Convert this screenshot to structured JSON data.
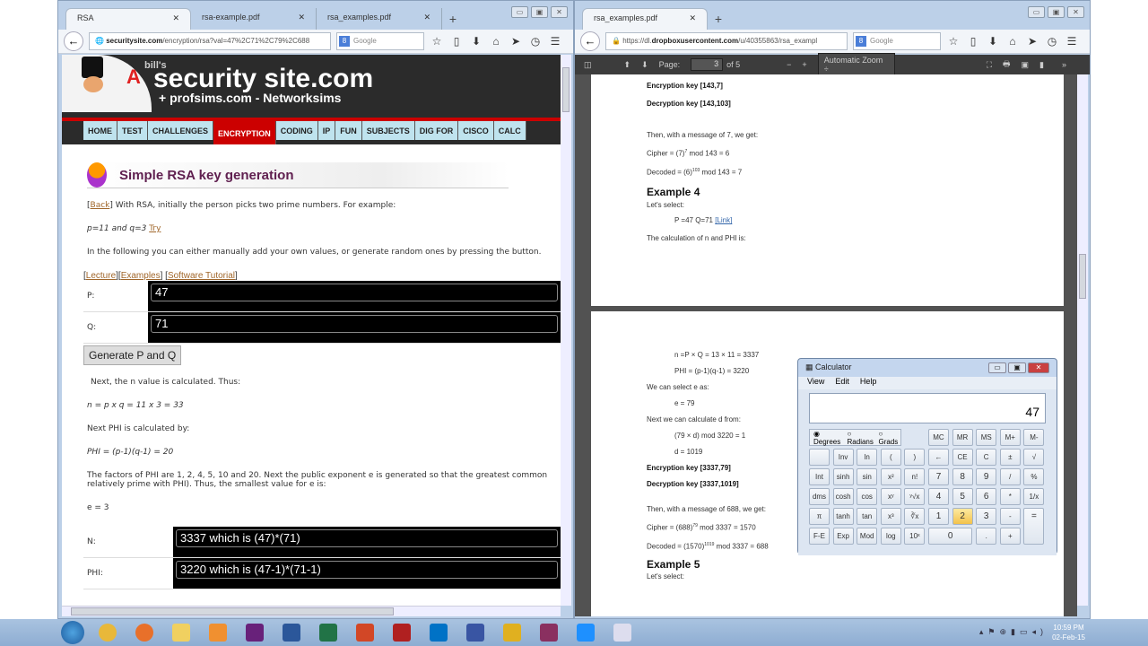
{
  "left_browser": {
    "tabs": [
      {
        "label": "RSA"
      },
      {
        "label": "rsa-example.pdf"
      },
      {
        "label": "rsa_examples.pdf"
      }
    ],
    "url_domain": "securitysite.com",
    "url_path": "/encryption/rsa?val=47%2C71%2C79%2C688",
    "search_placeholder": "Google",
    "site": {
      "logo_small": "bill's",
      "logo_main": "security site.com",
      "logo_sub": "+ profsims.com - Networksims",
      "logo_letter": "A",
      "nav": [
        "HOME",
        "TEST",
        "CHALLENGES",
        "ENCRYPTION",
        "CODING",
        "IP",
        "FUN",
        "SUBJECTS",
        "DIG FOR",
        "CISCO",
        "CALC"
      ],
      "title": "Simple RSA key generation",
      "intro_back": "Back",
      "intro": "With RSA, initially the person picks two prime numbers. For example:",
      "example": "p=11 and q=3",
      "try": "Try",
      "following": "In the following you can either manually add your own values, or generate random ones by pressing the button.",
      "links": [
        "Lecture",
        "Examples",
        "Software Tutorial"
      ],
      "p_label": "P:",
      "p_value": "47",
      "q_label": "Q:",
      "q_value": "71",
      "generate": "Generate P and Q",
      "next_n": "Next, the n value is calculated. Thus:",
      "n_eq": "n = p x q = 11 x 3 = 33",
      "next_phi": "Next PHI is calculated by:",
      "phi_eq": "PHI = (p-1)(q-1) = 20",
      "factors": "The factors of PHI are 1, 2, 4, 5, 10 and 20. Next the public exponent e is generated so that the greatest common",
      "factors2": "relatively prime with PHI). Thus, the smallest value for e is:",
      "e_eq": "e = 3",
      "n_label": "N:",
      "n_value": "3337 which is (47)*(71)",
      "phi_label": "PHI:",
      "phi_value": "3220 which is (47-1)*(71-1)"
    }
  },
  "right_browser": {
    "tabs": [
      {
        "label": "rsa_examples.pdf"
      }
    ],
    "url_prefix": "https://dl.",
    "url_domain": "dropboxusercontent.com",
    "url_path": "/u/40355863/rsa_exampl",
    "search_placeholder": "Google",
    "pdf_toolbar": {
      "page_label": "Page:",
      "page": "3",
      "of": "of 5",
      "zoom": "Automatic Zoom"
    },
    "page1": {
      "enc": "Encryption key [143,7]",
      "dec": "Decryption key [143,103]",
      "then": "Then, with a message of 7, we get:",
      "cipher": "Cipher = (7)",
      "cipher_exp": "7",
      "cipher_rest": " mod 143 = 6",
      "decoded": "Decoded = (6)",
      "decoded_exp": "103",
      "decoded_rest": " mod 143 = 7",
      "heading": "Example 4",
      "select": "Let's select:",
      "pq": "P =47 Q=71 ",
      "link": "[Link]",
      "calc": "The calculation of n and PHI is:"
    },
    "page2": {
      "n": "n =P × Q = 13 × 11 = 3337",
      "phi": "PHI = (p-1)(q-1) = 3220",
      "select_e": "We can select e as:",
      "e": "e = 79",
      "next_d": "Next we can calculate d from:",
      "d_eq": "(79 × d) mod 3220 = 1",
      "d": "d = 1019",
      "enc": "Encryption key [3337,79]",
      "dec": "Decryption key [3337,1019]",
      "then": "Then, with a message of 688, we get:",
      "cipher": "Cipher = (688)",
      "cipher_exp": "79",
      "cipher_rest": " mod 3337 = 1570",
      "decoded": "Decoded = (1570)",
      "decoded_exp": "1019",
      "decoded_rest": " mod 3337 = 688",
      "heading": "Example 5",
      "select": "Let's select:"
    }
  },
  "calculator": {
    "title": "Calculator",
    "menu": [
      "View",
      "Edit",
      "Help"
    ],
    "display": "47",
    "angle": [
      "Degrees",
      "Radians",
      "Grads"
    ],
    "rows": [
      [
        "MC",
        "MR",
        "MS",
        "M+",
        "M-"
      ],
      [
        "",
        "Inv",
        "ln",
        "(",
        ")",
        "←",
        "CE",
        "C",
        "±",
        "√"
      ],
      [
        "Int",
        "sinh",
        "sin",
        "x²",
        "n!",
        "7",
        "8",
        "9",
        "/",
        "%"
      ],
      [
        "dms",
        "cosh",
        "cos",
        "xʸ",
        "ʸ√x",
        "4",
        "5",
        "6",
        "*",
        "1/x"
      ],
      [
        "π",
        "tanh",
        "tan",
        "x³",
        "∛x",
        "1",
        "2",
        "3",
        "-",
        "="
      ],
      [
        "F-E",
        "Exp",
        "Mod",
        "log",
        "10ˣ",
        "0",
        ".",
        "+"
      ]
    ]
  },
  "taskbar": {
    "time": "10:59 PM",
    "date": "02-Feb-15",
    "apps": [
      "chrome",
      "firefox",
      "explorer",
      "media-player",
      "visual-studio",
      "word",
      "excel",
      "powerpoint",
      "filezilla",
      "outlook",
      "visio",
      "slides",
      "winrar",
      "internet-explorer",
      "calculator"
    ]
  }
}
